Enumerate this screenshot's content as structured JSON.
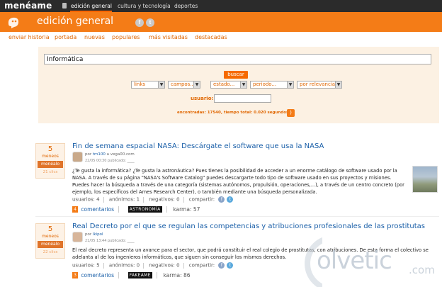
{
  "topbar": {
    "logo": "menéame",
    "nav": [
      "edición general",
      "cultura y tecnología",
      "deportes"
    ]
  },
  "header": {
    "title": "edición general",
    "social": [
      "f",
      "t"
    ]
  },
  "subnav": [
    "enviar historia",
    "portada",
    "nuevas",
    "populares",
    "más visitadas",
    "destacadas"
  ],
  "search": {
    "value": "Informática",
    "button": "buscar",
    "selects": [
      "links",
      "campos...",
      "estado...",
      "periodo...",
      "por relevancia"
    ],
    "usuario_label": "usuario:",
    "results": "encontradas: 17540, tiempo total: 0.020 segundos"
  },
  "news": [
    {
      "votes": "5",
      "votes_label": "meneos",
      "vote_button": "menéalo",
      "clicks": "21 clics",
      "title": "Fin de semana espacial NASA: Descárgate el software que usa la NASA",
      "meta_by": "por",
      "meta_user": "tm100",
      "meta_via": "a vega00.com",
      "meta_date": "22/05 00:30 publicado: ____",
      "body": "¿Te gusta la informática? ¿Te gusta la astronáutica? Pues tienes la posibilidad de acceder a un enorme catálogo de software usado por la NASA. A través de su página \"NASA's Software Catalog\" puedes descargarte todo tipo de software usado en sus proyectos y misiones. Puedes hacer la búsqueda a través de una categoría (sistemas autónomos, propulsión, operaciones,...), a través de un centro concreto (por ejemplo, los específicos del Ames Research Center), o también mediante una búsqueda personalizada.",
      "stats": {
        "usuarios": "usuarios: 4",
        "anonimos": "anónimos: 1",
        "negativos": "negativos: 0",
        "compartir": "compartir:"
      },
      "comments_count": "4",
      "comments_label": "comentarios",
      "tag": "ASTRONOMÍA",
      "karma": "karma: 57"
    },
    {
      "votes": "5",
      "votes_label": "meneos",
      "vote_button": "menéalo",
      "clicks": "22 clics",
      "title": "Real Decreto por el que se regulan las competencias y atribuciones profesionales de las prostitutas",
      "meta_by": "por",
      "meta_user": "lkipol",
      "meta_via": "",
      "meta_date": "21/05 13:44 publicado: ____",
      "body": "El real decreto representa un avance para el sector, que podrá constituir el real colegio de prostitutas, con atribuciones. De esta forma el colectivo se adelanta al de los ingenieros informáticos, que siguen sin conseguir los mismos derechos.",
      "stats": {
        "usuarios": "usuarios: 5",
        "anonimos": "anónimos: 0",
        "negativos": "negativos: 0",
        "compartir": "compartir:"
      },
      "comments_count": "3",
      "comments_label": "comentarios",
      "tag": "FAKEAME",
      "karma": "karma: 86"
    }
  ],
  "watermark": {
    "text": "olvetic",
    "suffix": ".com"
  }
}
